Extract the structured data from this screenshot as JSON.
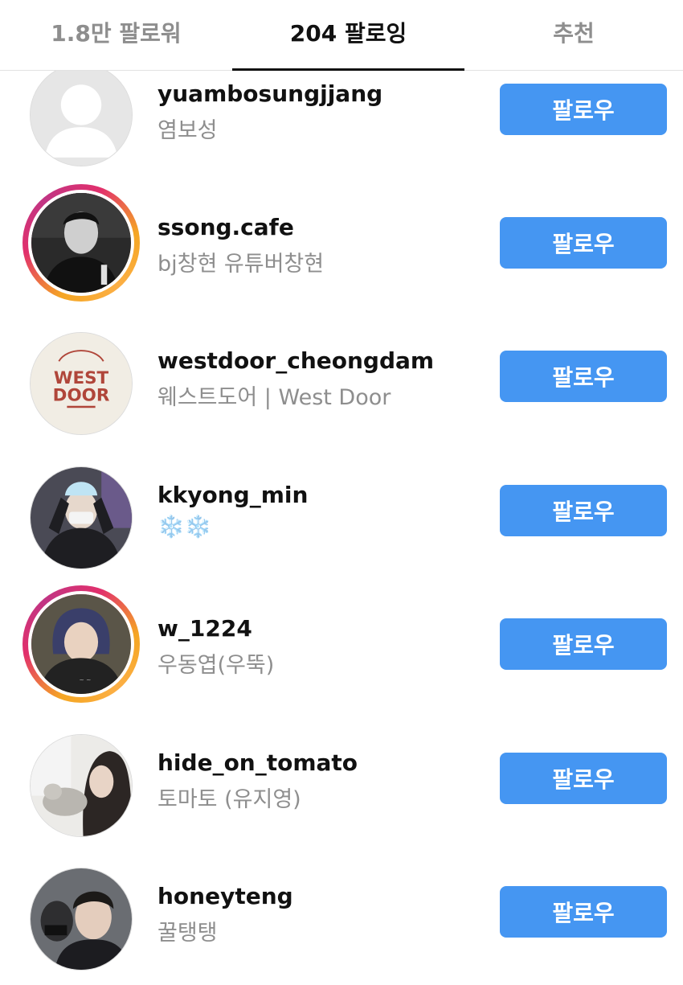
{
  "tabs": [
    {
      "label": "1.8만 팔로워",
      "active": false
    },
    {
      "label": "204 팔로잉",
      "active": true
    },
    {
      "label": "추천",
      "active": false
    }
  ],
  "colors": {
    "follow_button": "#4596f2",
    "story_ring_start": "#f5a623",
    "story_ring_end": "#e1306c",
    "secondary_text": "#8e8e8e"
  },
  "users": [
    {
      "username": "yuambosungjjang",
      "full_name": "염보성",
      "button": "팔로우",
      "story_ring": false,
      "avatar": "default-avatar-icon"
    },
    {
      "username": "ssong.cafe",
      "full_name": "bj창현 유튜버창현",
      "button": "팔로우",
      "story_ring": true,
      "avatar": "profile-photo"
    },
    {
      "username": "westdoor_cheongdam",
      "full_name": "웨스트도어 | West Door",
      "button": "팔로우",
      "story_ring": false,
      "avatar": "west-door-logo",
      "logo_text": "WEST DOOR"
    },
    {
      "username": "kkyong_min",
      "full_name": "❄️❄️",
      "button": "팔로우",
      "story_ring": false,
      "avatar": "profile-photo"
    },
    {
      "username": "w_1224",
      "full_name": "우동엽(우뚝)",
      "button": "팔로우",
      "story_ring": true,
      "avatar": "profile-photo"
    },
    {
      "username": "hide_on_tomato",
      "full_name": "토마토 (유지영)",
      "button": "팔로우",
      "story_ring": false,
      "avatar": "profile-photo"
    },
    {
      "username": "honeyteng",
      "full_name": "꿀탱탱",
      "button": "팔로우",
      "story_ring": false,
      "avatar": "profile-photo"
    }
  ]
}
